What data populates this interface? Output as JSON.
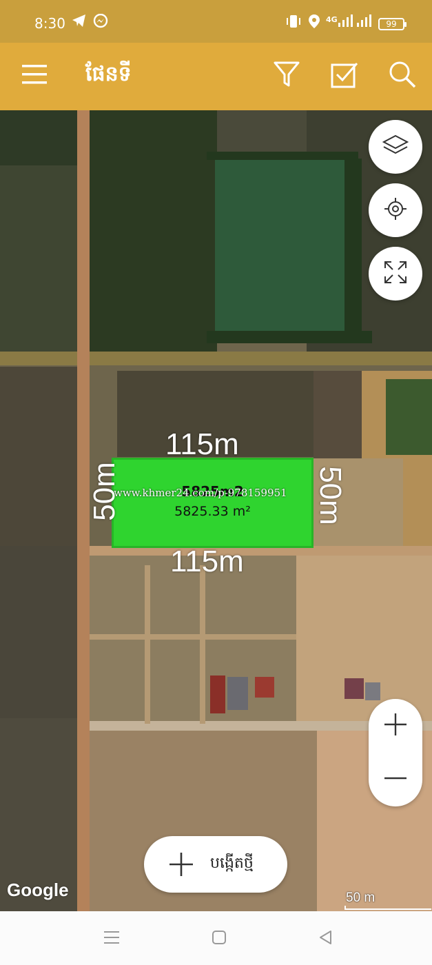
{
  "status_bar": {
    "time": "8:30",
    "network": "4G",
    "battery": "99"
  },
  "app_bar": {
    "menu_icon": "menu-icon",
    "title": "ផែនទី",
    "filter_icon": "filter-icon",
    "checklist_icon": "checkbox-icon",
    "search_icon": "search-icon",
    "color": "#e0ab3c"
  },
  "map": {
    "controls": {
      "layers_icon": "layers-icon",
      "locate_icon": "locate-icon",
      "fullscreen_icon": "fullscreen-icon",
      "zoom_in_icon": "plus-icon",
      "zoom_out_icon": "minus-icon"
    },
    "plot": {
      "top_length": "115m",
      "bottom_length": "115m",
      "left_width": "50m",
      "right_width": "50m",
      "area_label": "5825m2",
      "area_measure": "5825.33 m²",
      "watermark": "www.khmer24.com/p-978159951",
      "fill_color": "#2fd42f"
    },
    "create_button": {
      "label": "បង្កើតថ្មី",
      "icon": "plus-icon"
    },
    "attribution": "Google",
    "scale_label": "50 m"
  },
  "nav_bar": {
    "menu_icon": "recent-apps-icon",
    "home_icon": "home-icon",
    "back_icon": "back-icon"
  }
}
